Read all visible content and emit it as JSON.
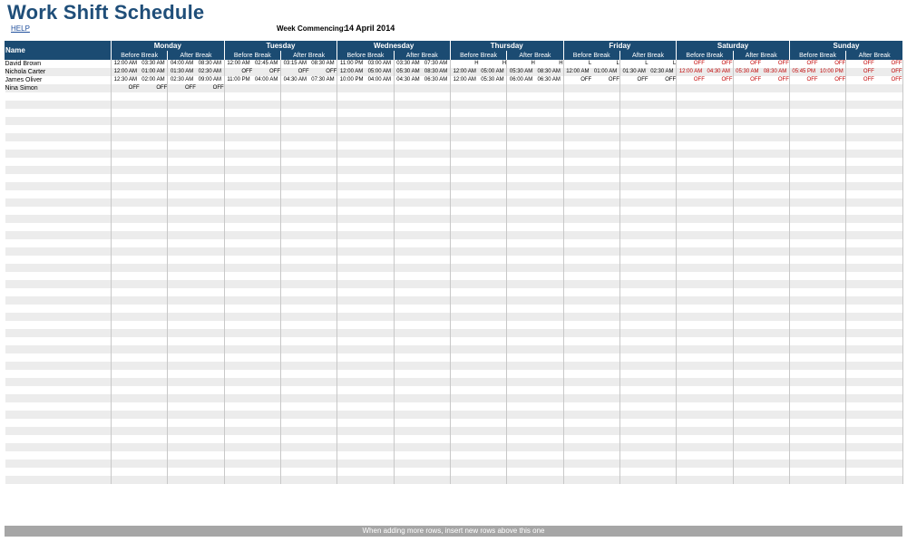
{
  "title": "Work Shift Schedule",
  "help_link": "HELP",
  "week_commencing_label": "Week Commencing:",
  "week_commencing_value": "14 April 2014",
  "name_header": "Name",
  "sub_labels": [
    "Before Break",
    "After Break"
  ],
  "days": [
    "Monday",
    "Tuesday",
    "Wednesday",
    "Thursday",
    "Friday",
    "Saturday",
    "Sunday"
  ],
  "employees": [
    {
      "name": "David Brown",
      "shifts": [
        "12:00 AM",
        "03:30 AM",
        "04:00 AM",
        "08:30 AM",
        "12:00 AM",
        "02:45 AM",
        "03:15 AM",
        "08:30 AM",
        "11:00 PM",
        "03:00 AM",
        "03:30 AM",
        "07:30 AM",
        "H",
        "H",
        "H",
        "H",
        "L",
        "L",
        "L",
        "L",
        "OFF",
        "OFF",
        "OFF",
        "OFF",
        "OFF",
        "OFF",
        "OFF",
        "OFF"
      ]
    },
    {
      "name": "Nichola Carter",
      "shifts": [
        "12:00 AM",
        "01:00 AM",
        "01:30 AM",
        "02:30 AM",
        "OFF",
        "OFF",
        "OFF",
        "OFF",
        "12:00 AM",
        "05:00 AM",
        "05:30 AM",
        "08:30 AM",
        "12:00 AM",
        "05:00 AM",
        "05:30 AM",
        "08:30 AM",
        "12:00 AM",
        "01:00 AM",
        "01:30 AM",
        "02:30 AM",
        "12:00 AM",
        "04:30 AM",
        "05:30 AM",
        "08:30 AM",
        "05:45 PM",
        "10:00 PM",
        "OFF",
        "OFF"
      ]
    },
    {
      "name": "James Oliver",
      "shifts": [
        "12:30 AM",
        "02:00 AM",
        "02:30 AM",
        "09:00 AM",
        "11:00 PM",
        "04:00 AM",
        "04:30 AM",
        "07:30 AM",
        "10:00 PM",
        "04:00 AM",
        "04:30 AM",
        "06:30 AM",
        "12:00 AM",
        "05:30 AM",
        "06:00 AM",
        "06:30 AM",
        "OFF",
        "OFF",
        "OFF",
        "OFF",
        "OFF",
        "OFF",
        "OFF",
        "OFF",
        "OFF",
        "OFF",
        "OFF",
        "OFF"
      ]
    },
    {
      "name": "Nina Simon",
      "shifts": [
        "OFF",
        "OFF",
        "OFF",
        "OFF",
        "",
        "",
        "",
        "",
        "",
        "",
        "",
        "",
        "",
        "",
        "",
        "",
        "",
        "",
        "",
        "",
        "",
        "",
        "",
        "",
        "",
        "",
        "",
        ""
      ]
    }
  ],
  "footer_note": "When adding more rows, insert new rows above this one",
  "colors": {
    "header_bg": "#1b4b72",
    "title": "#1f4e79",
    "weekend_text": "#c00000",
    "row_alt": "#ececec",
    "footer_bg": "#a6a6a6"
  }
}
